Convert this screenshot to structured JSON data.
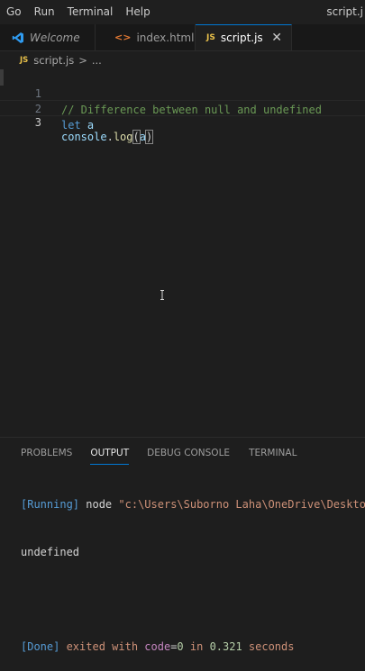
{
  "menubar": {
    "items": [
      "Go",
      "Run",
      "Terminal",
      "Help"
    ],
    "window_title": "script.j"
  },
  "tabs": [
    {
      "label": "Welcome",
      "icon": "vscode-logo-icon"
    },
    {
      "label": "index.html",
      "icon": "html-file-icon",
      "icon_glyph": "<>"
    },
    {
      "label": "script.js",
      "icon": "js-file-icon",
      "icon_glyph": "JS",
      "close": "✕",
      "active": true
    }
  ],
  "breadcrumb": {
    "file_icon": "JS",
    "file": "script.js",
    "separator": ">",
    "rest": "..."
  },
  "editor": {
    "lines": [
      {
        "num": "1",
        "comment": "// Difference between null and undefined"
      },
      {
        "num": "2",
        "kw": "let",
        "var": "a"
      },
      {
        "num": "3",
        "obj": "console",
        "dot": ".",
        "fn": "log",
        "open": "(",
        "arg": "a",
        "close": ")"
      }
    ]
  },
  "panel": {
    "tabs": [
      "PROBLEMS",
      "OUTPUT",
      "DEBUG CONSOLE",
      "TERMINAL"
    ],
    "active_tab": "OUTPUT"
  },
  "output": {
    "running_tag": "[Running]",
    "running_cmd": " node ",
    "running_path": "\"c:\\Users\\Suborno Laha\\OneDrive\\Deskto",
    "result": "undefined",
    "done_tag": "[Done]",
    "done_text1": " exited with ",
    "done_code_kw": "code",
    "done_eq": "=",
    "done_code": "0",
    "done_in": " in ",
    "done_time": "0.321",
    "done_seconds": " seconds"
  },
  "colors": {
    "accent": "#0078d4",
    "comment": "#6a9955",
    "keyword": "#569cd6",
    "function": "#dcdcaa",
    "js_icon": "#e8c04a"
  }
}
